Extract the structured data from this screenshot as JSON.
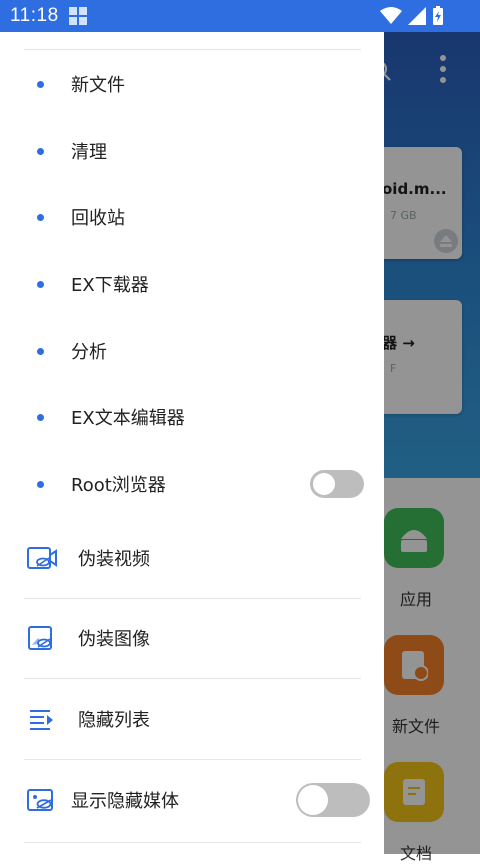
{
  "status_bar": {
    "time": "11:18"
  },
  "background_app": {
    "card1_title": "oid.m...",
    "card1_sub": "7 GB",
    "card2_title": "器 →",
    "card2_sub": "F",
    "apps": [
      {
        "label": "应用"
      },
      {
        "label": "新文件"
      },
      {
        "label": "文档"
      }
    ]
  },
  "drawer": {
    "items": [
      {
        "label": "新文件"
      },
      {
        "label": "清理"
      },
      {
        "label": "回收站"
      },
      {
        "label": "EX下载器"
      },
      {
        "label": "分析"
      },
      {
        "label": "EX文本编辑器"
      },
      {
        "label": "Root浏览器",
        "toggle": false
      }
    ],
    "media_items": [
      {
        "label": "伪装视频",
        "icon": "disguise-video-icon"
      },
      {
        "label": "伪装图像",
        "icon": "disguise-image-icon"
      },
      {
        "label": "隐藏列表",
        "icon": "hidden-list-icon"
      },
      {
        "label": "显示隐藏媒体",
        "icon": "show-hidden-media-icon",
        "toggle": false
      }
    ]
  },
  "colors": {
    "accent": "#2f6ee0",
    "toggle_off": "#bdbdbd"
  }
}
